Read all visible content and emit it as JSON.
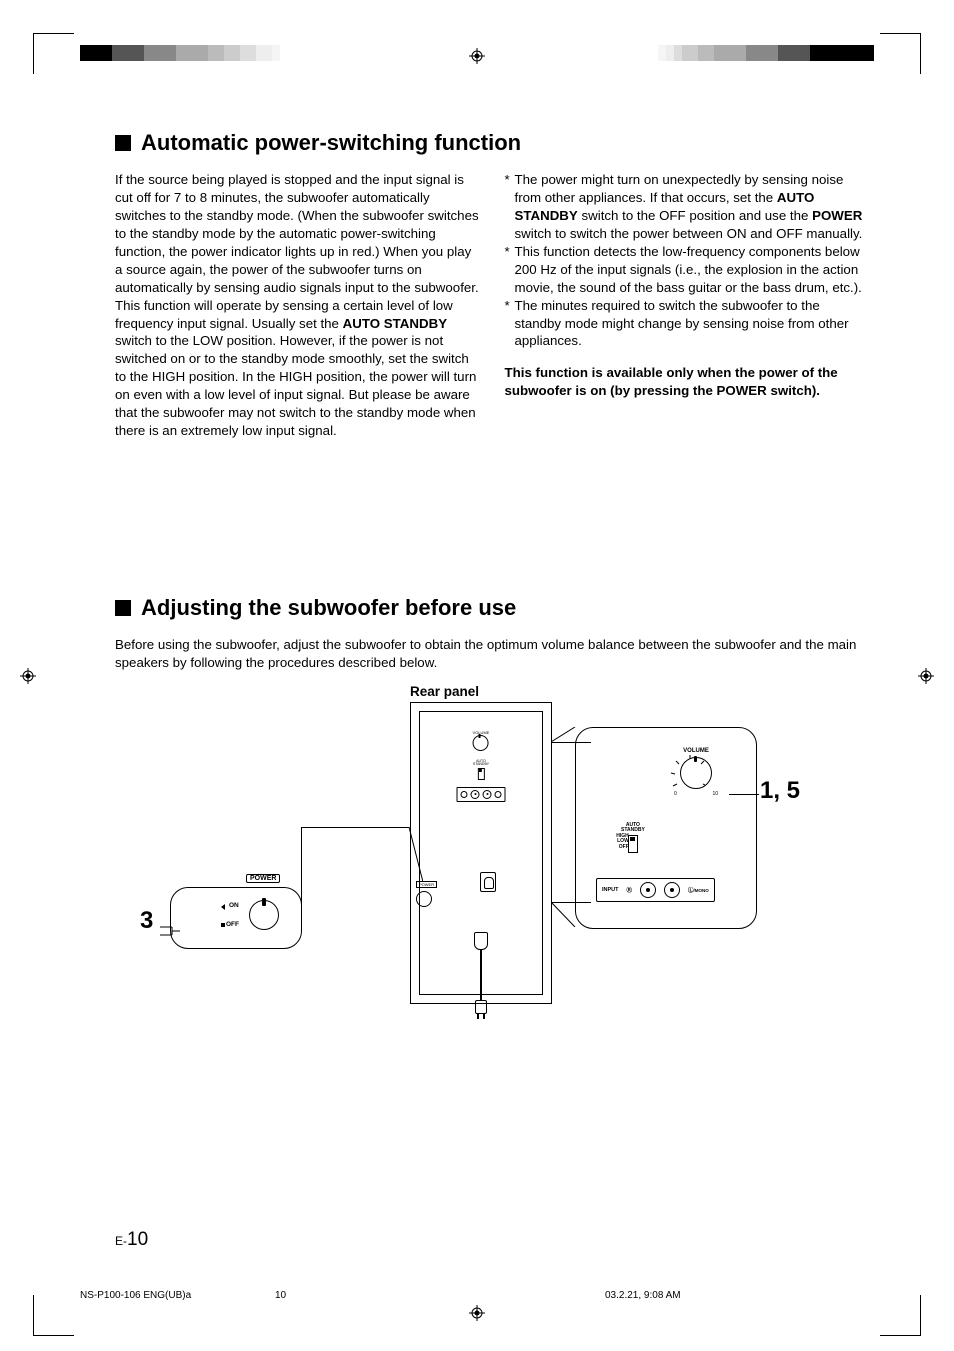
{
  "section1": {
    "title": "Automatic power-switching function",
    "left_para1": "If the source being played is stopped and the input signal is cut off for 7 to 8 minutes, the subwoofer automatically switches to the standby mode. (When the subwoofer switches to the standby mode by the automatic power-switching function, the power indicator lights up in red.) When you play a source again, the power of the subwoofer turns on automatically by sensing audio signals input to the subwoofer.",
    "left_para2a": "This function will operate by sensing a certain level of low frequency input signal. Usually set the ",
    "left_bold1": "AUTO STANDBY",
    "left_para2b": " switch to the LOW position. However, if the power is not switched on or to the standby mode smoothly, set the switch to the HIGH position. In the HIGH position, the power will turn on even with a low level of input signal. But please be aware that the subwoofer may not switch to the standby mode when there is an extremely low input signal.",
    "bullet1a": "The power might turn on unexpectedly by sensing noise from other appliances. If that occurs, set the ",
    "bullet1b": "AUTO STANDBY",
    "bullet1c": " switch to the OFF position and use the ",
    "bullet1d": "POWER",
    "bullet1e": " switch to switch the power between ON and OFF manually.",
    "bullet2": "This function detects the low-frequency components below 200 Hz of the input signals (i.e., the explosion in the action movie, the sound of the bass guitar or the bass drum, etc.).",
    "bullet3": "The minutes required to switch the subwoofer to the standby mode might change by sensing noise from other appliances.",
    "note": "This function is available only when the power of the subwoofer is on (by pressing the POWER switch)."
  },
  "section2": {
    "title": "Adjusting the subwoofer before use",
    "intro": "Before using the subwoofer, adjust the subwoofer to obtain the optimum volume balance between the subwoofer and the main speakers by following the procedures described below."
  },
  "diagram": {
    "rear_panel": "Rear panel",
    "step3": "3",
    "step15": "1, 5",
    "power": "POWER",
    "on": "ON",
    "off": "OFF",
    "volume": "VOLUME",
    "scale0": "0",
    "scale10": "10",
    "auto_standby_1": "AUTO",
    "auto_standby_2": "STANDBY",
    "high": "HIGH",
    "low": "LOW",
    "off2": "OFF",
    "input": "INPUT",
    "r": "R",
    "l": "L",
    "mono": "/MONO"
  },
  "footer": {
    "e": "E-",
    "page": "10",
    "doc_left": "NS-P100-106 ENG(UB)a",
    "doc_mid": "10",
    "doc_right": "03.2.21, 9:08 AM"
  }
}
